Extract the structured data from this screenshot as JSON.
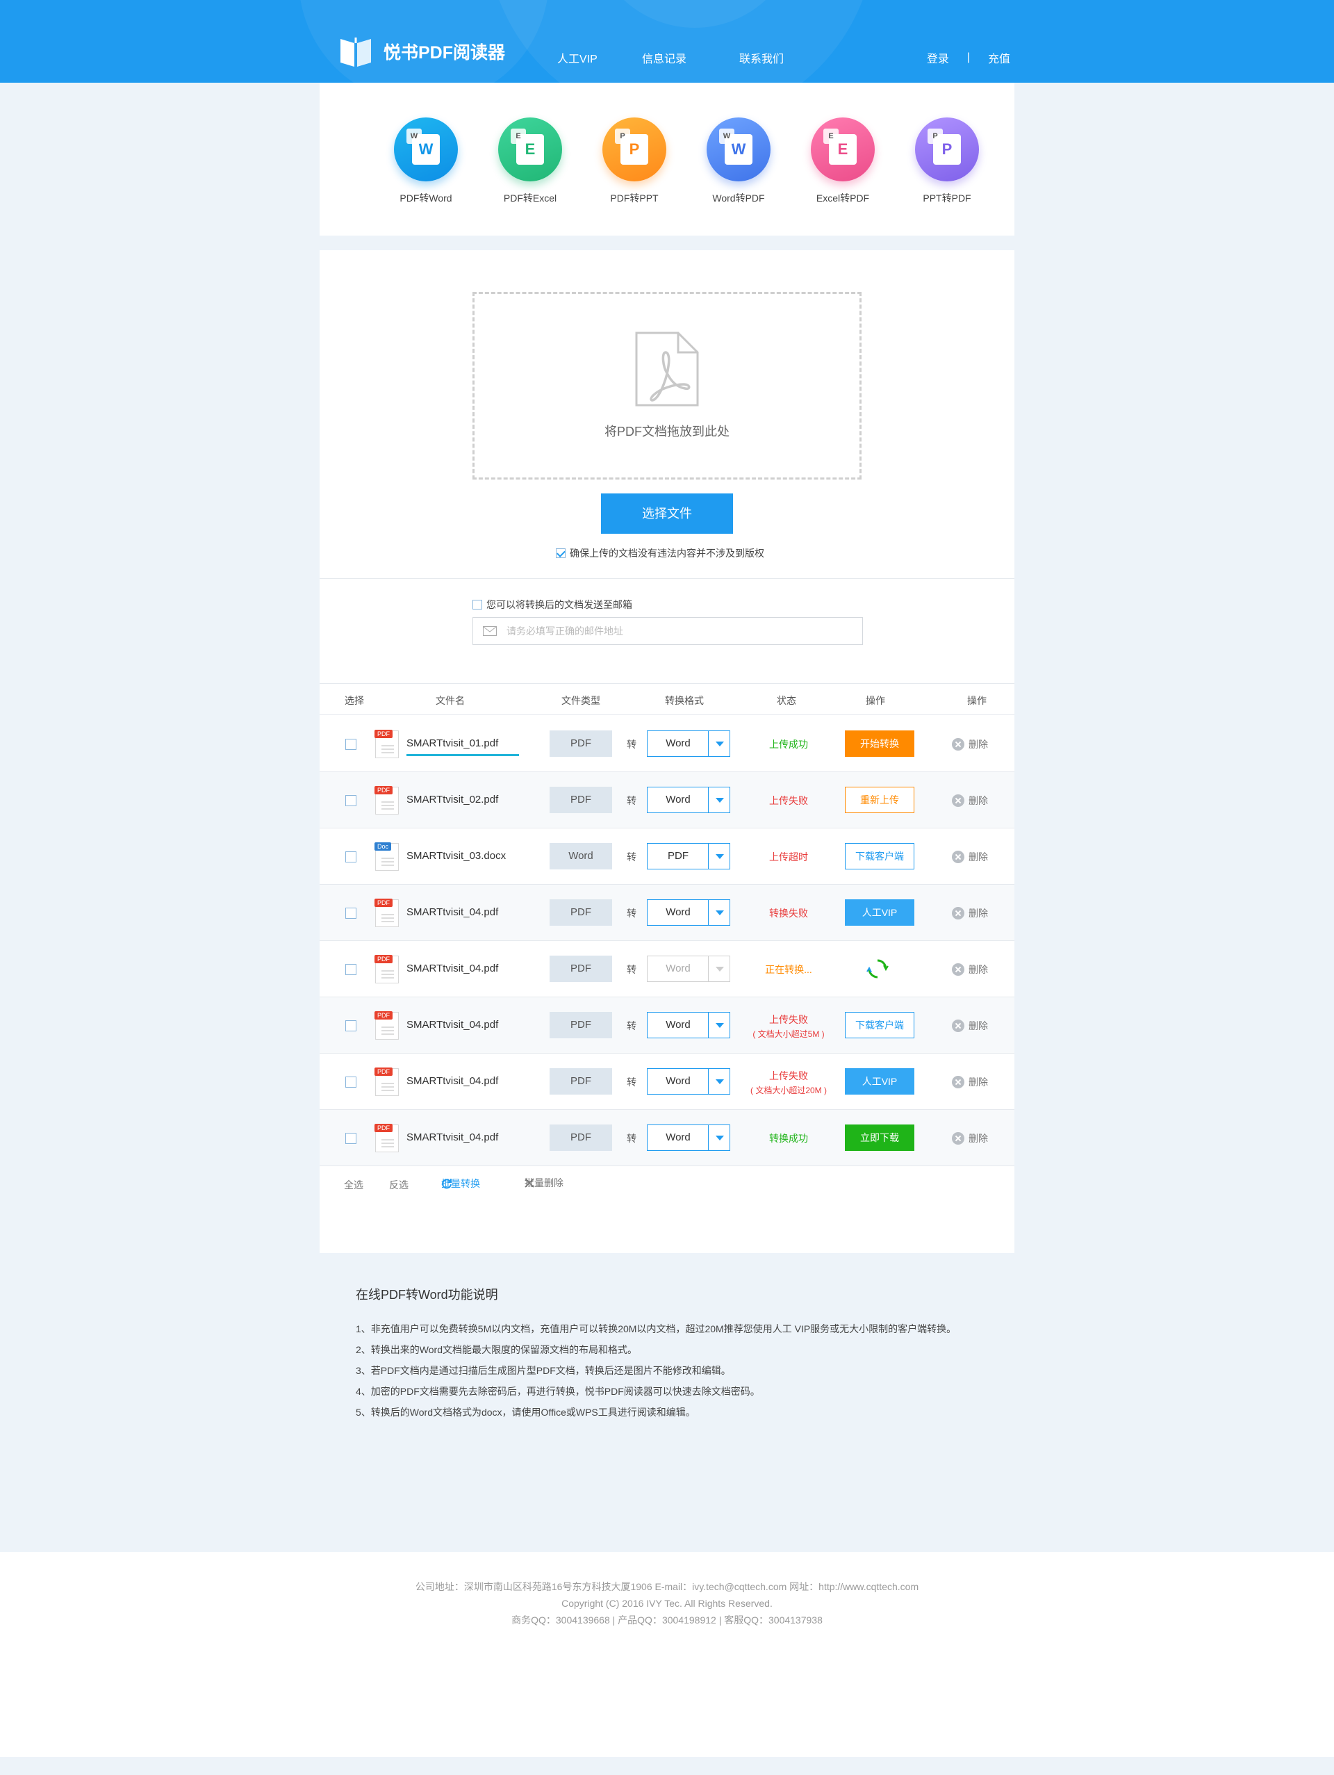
{
  "header": {
    "app_title": "悦书PDF阅读器",
    "nav": [
      "人工VIP",
      "信息记录",
      "联系我们"
    ],
    "login": "登录",
    "separator": "|",
    "recharge": "充值"
  },
  "tools": [
    {
      "label": "PDF转Word",
      "badge": "W",
      "icon": "pdf-to-word-icon",
      "color_from": "#1fb6f0",
      "color_to": "#0d8fe6",
      "fg": "#1296e8"
    },
    {
      "label": "PDF转Excel",
      "badge": "E",
      "icon": "pdf-to-excel-icon",
      "color_from": "#3ed59b",
      "color_to": "#21b776",
      "fg": "#21b776"
    },
    {
      "label": "PDF转PPT",
      "badge": "P",
      "icon": "pdf-to-ppt-icon",
      "color_from": "#ffb53a",
      "color_to": "#ff8a1a",
      "fg": "#ff8a1a"
    },
    {
      "label": "Word转PDF",
      "badge": "W",
      "icon": "word-to-pdf-icon",
      "color_from": "#6ea3ff",
      "color_to": "#3f74ea",
      "fg": "#3f74ea"
    },
    {
      "label": "Excel转PDF",
      "badge": "E",
      "icon": "excel-to-pdf-icon",
      "color_from": "#ff7bb0",
      "color_to": "#ec4d8a",
      "fg": "#ec4d8a"
    },
    {
      "label": "PPT转PDF",
      "badge": "P",
      "icon": "ppt-to-pdf-icon",
      "color_from": "#b093ff",
      "color_to": "#7f61ea",
      "fg": "#7f61ea"
    }
  ],
  "upload": {
    "drop_text": "将PDF文档拖放到此处",
    "select_button": "选择文件",
    "agree_text": "确保上传的文档没有违法内容并不涉及到版权",
    "agree_checked": true,
    "email_option": "您可以将转换后的文档发送至邮箱",
    "email_checked": false,
    "email_placeholder": "请务必填写正确的邮件地址"
  },
  "table": {
    "headers": [
      "选择",
      "文件名",
      "文件类型",
      "转换格式",
      "状态",
      "操作",
      "操作"
    ],
    "to_label": "转",
    "delete_label": "删除",
    "rows": [
      {
        "name": "SMARTtvisit_01.pdf",
        "tag": "PDF",
        "type": "PDF",
        "format": "Word",
        "status": "上传成功",
        "status_color": "#1fb418",
        "status_sub": "",
        "action": "开始转换",
        "action_style": "orange-solid",
        "progress": 1.0,
        "format_disabled": false
      },
      {
        "name": "SMARTtvisit_02.pdf",
        "tag": "PDF",
        "type": "PDF",
        "format": "Word",
        "status": "上传失败",
        "status_color": "#e83a3a",
        "status_sub": "",
        "action": "重新上传",
        "action_style": "orange-outline",
        "format_disabled": false
      },
      {
        "name": "SMARTtvisit_03.docx",
        "tag": "Doc",
        "type": "Word",
        "format": "PDF",
        "status": "上传超时",
        "status_color": "#e83a3a",
        "status_sub": "",
        "action": "下载客户端",
        "action_style": "blue-outline",
        "format_disabled": false
      },
      {
        "name": "SMARTtvisit_04.pdf",
        "tag": "PDF",
        "type": "PDF",
        "format": "Word",
        "status": "转换失败",
        "status_color": "#e83a3a",
        "status_sub": "",
        "action": "人工VIP",
        "action_style": "blue-solid",
        "format_disabled": false
      },
      {
        "name": "SMARTtvisit_04.pdf",
        "tag": "PDF",
        "type": "PDF",
        "format": "Word",
        "status": "正在转换...",
        "status_color": "#ff8a00",
        "status_sub": "",
        "action": "",
        "action_style": "spinner",
        "format_disabled": true
      },
      {
        "name": "SMARTtvisit_04.pdf",
        "tag": "PDF",
        "type": "PDF",
        "format": "Word",
        "status": "上传失败",
        "status_color": "#e83a3a",
        "status_sub": "( 文档大小超过5M )",
        "action": "下载客户端",
        "action_style": "blue-outline",
        "format_disabled": false
      },
      {
        "name": "SMARTtvisit_04.pdf",
        "tag": "PDF",
        "type": "PDF",
        "format": "Word",
        "status": "上传失败",
        "status_color": "#e83a3a",
        "status_sub": "( 文档大小超过20M )",
        "action": "人工VIP",
        "action_style": "blue-solid",
        "format_disabled": false
      },
      {
        "name": "SMARTtvisit_04.pdf",
        "tag": "PDF",
        "type": "PDF",
        "format": "Word",
        "status": "转换成功",
        "status_color": "#1fb418",
        "status_sub": "",
        "action": "立即下载",
        "action_style": "green-solid",
        "format_disabled": false
      }
    ],
    "bulk": {
      "select_all": "全选",
      "invert": "反选",
      "batch_convert": "批量转换",
      "batch_delete": "批量删除"
    }
  },
  "info": {
    "title": "在线PDF转Word功能说明",
    "items": [
      "1、非充值用户可以免费转换5M以内文档，充值用户可以转换20M以内文档，超过20M推荐您使用人工 VIP服务或无大小限制的客户端转换。",
      "2、转换出来的Word文档能最大限度的保留源文档的布局和格式。",
      "3、若PDF文档内是通过扫描后生成图片型PDF文档，转换后还是图片不能修改和编辑。",
      "4、加密的PDF文档需要先去除密码后，再进行转换，悦书PDF阅读器可以快速去除文档密码。",
      "5、转换后的Word文档格式为docx，请使用Office或WPS工具进行阅读和编辑。"
    ]
  },
  "footer": {
    "line1": "公司地址：深圳市南山区科苑路16号东方科技大厦1906   E-mail：ivy.tech@cqttech.com   网址：http://www.cqttech.com",
    "line2": "Copyright (C) 2016 IVY Tec. All Rights Reserved.",
    "line3": "商务QQ：3004139668 | 产品QQ：3004198912 | 客服QQ：3004137938"
  },
  "colors": {
    "brand": "#1f9bf0",
    "success": "#1fb418",
    "error": "#e83a3a",
    "warning": "#ff8a00"
  }
}
